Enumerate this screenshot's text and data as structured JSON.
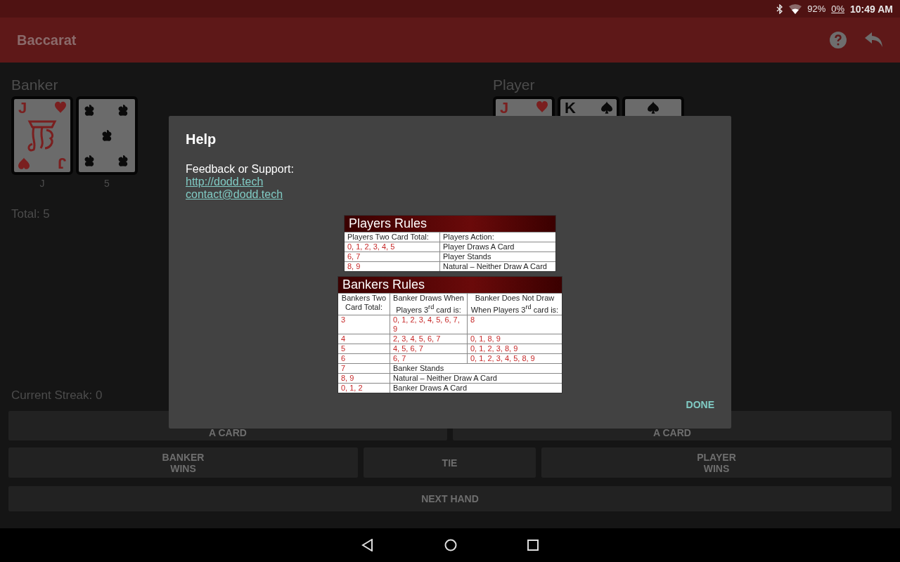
{
  "status_bar": {
    "battery": "92%",
    "data": "0%",
    "time": "10:49 AM"
  },
  "app_bar": {
    "title": "Baccarat"
  },
  "banker": {
    "title": "Banker",
    "cards": [
      {
        "kind": "face",
        "suit": {
          "kind": "hearts"
        },
        "rank": "J",
        "rank_bottom": "J",
        "label": "J"
      },
      {
        "kind": "pips",
        "suit": {
          "kind": "clubs"
        },
        "label": "5"
      }
    ],
    "total": "Total: 5"
  },
  "player": {
    "title": "Player",
    "cards": [
      {
        "kind": "face",
        "suit": {
          "kind": "hearts"
        },
        "rank": "J"
      },
      {
        "kind": "face",
        "suit": {
          "kind": "spades"
        },
        "rank": "K"
      },
      {
        "kind": "pips",
        "suit": {
          "kind": "spades"
        }
      }
    ]
  },
  "streak": "Current Streak: 0",
  "buttons": {
    "draw_row": [
      "A CARD",
      "A CARD"
    ],
    "result_row": [
      "BANKER\nWINS",
      "TIE",
      "PLAYER\nWINS"
    ],
    "next": "NEXT HAND"
  },
  "dialog": {
    "title": "Help",
    "text": "Feedback or Support:",
    "links": [
      "http://dodd.tech",
      "contact@dodd.tech"
    ],
    "players_rules": {
      "title": "Players Rules",
      "header": [
        "Players Two Card Total:",
        "Players Action:"
      ],
      "rows": [
        {
          "total": "0, 1, 2, 3, 4, 5",
          "action": "Player Draws A Card"
        },
        {
          "total": "6, 7",
          "action": "Player Stands"
        },
        {
          "total": "8, 9",
          "action": "Natural – Neither Draw A Card"
        }
      ]
    },
    "bankers_rules": {
      "title": "Bankers Rules",
      "header": [
        "Bankers Two Card Total:",
        "Banker Draws When Players 3$^{rd}$ card is:",
        "Banker Does Not Draw When Players 3$^{rd}$ card is:"
      ],
      "rows": [
        {
          "kind": "split",
          "total": "3",
          "draws": "0, 1, 2, 3, 4, 5, 6, 7, 9",
          "not_draws": "8"
        },
        {
          "kind": "split",
          "total": "4",
          "draws": "2, 3, 4, 5, 6, 7",
          "not_draws": "0, 1, 8, 9"
        },
        {
          "kind": "split",
          "total": "5",
          "draws": "4, 5, 6, 7",
          "not_draws": "0, 1, 2, 3, 8, 9"
        },
        {
          "kind": "split",
          "total": "6",
          "draws": "6, 7",
          "not_draws": "0, 1, 2, 3, 4, 5, 8, 9"
        },
        {
          "kind": "span",
          "total": "7",
          "action": "Banker Stands"
        },
        {
          "kind": "span",
          "total": "8, 9",
          "action": "Natural – Neither Draw A Card"
        },
        {
          "kind": "span",
          "total": "0, 1, 2",
          "action": "Banker Draws A Card"
        }
      ]
    },
    "done": "DONE"
  }
}
